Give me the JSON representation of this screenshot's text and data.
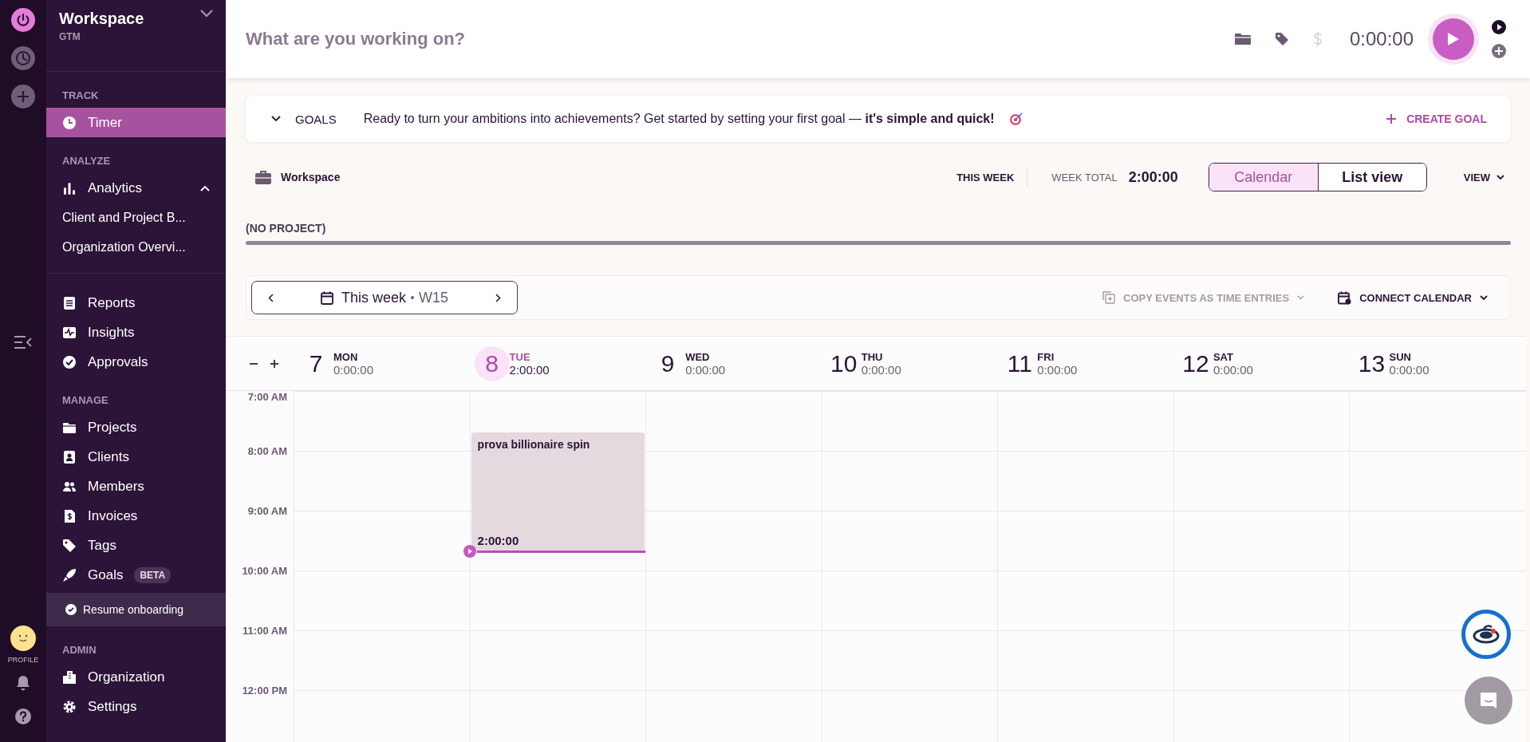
{
  "sidebar": {
    "workspace": "Workspace",
    "org": "GTM",
    "profile_label": "PROFILE",
    "sections": [
      {
        "title": "TRACK",
        "items": [
          {
            "label": "Timer",
            "selected": true
          }
        ]
      },
      {
        "title": "ANALYZE",
        "items": [
          {
            "label": "Analytics",
            "selected": false,
            "expanded": true,
            "children": [
              {
                "label": "Client and Project B...",
                "selected": false
              },
              {
                "label": "Organization Overvi...",
                "selected": false
              }
            ]
          }
        ]
      },
      {
        "items": [
          {
            "label": "Reports",
            "selected": false
          },
          {
            "label": "Insights",
            "selected": false
          },
          {
            "label": "Approvals",
            "selected": false
          }
        ]
      },
      {
        "title": "MANAGE",
        "items": [
          {
            "label": "Projects",
            "selected": false
          },
          {
            "label": "Clients",
            "selected": false
          },
          {
            "label": "Members",
            "selected": false
          },
          {
            "label": "Invoices",
            "selected": false
          },
          {
            "label": "Tags",
            "selected": false
          },
          {
            "label": "Goals",
            "badge": "BETA",
            "selected": false
          }
        ]
      },
      {
        "title": "ADMIN",
        "items": [
          {
            "label": "Organization",
            "selected": false
          },
          {
            "label": "Settings",
            "selected": false
          }
        ]
      }
    ],
    "onboarding": "Resume onboarding"
  },
  "timer": {
    "placeholder": "What are you working on?",
    "billable": false,
    "duration": "0:00:00"
  },
  "goals": {
    "label": "GOALS",
    "message": "Ready to turn your ambitions into achievements? Get started by setting your first goal — **it's simple and quick!**",
    "action": "CREATE GOAL"
  },
  "summary": {
    "workspace": "Workspace",
    "range": "THIS WEEK",
    "total_label": "WEEK TOTAL",
    "total": "2:00:00",
    "views": [
      {
        "label": "Calendar",
        "selected": true
      },
      {
        "label": "List view",
        "selected": false
      }
    ],
    "view_menu": "VIEW"
  },
  "projects": [
    {
      "name": "(NO PROJECT)",
      "level": 1
    }
  ],
  "week_nav": {
    "label": "This week",
    "week": "W15",
    "copy_action": "COPY EVENTS AS TIME ENTRIES",
    "copy_disabled": true,
    "connect_action": "CONNECT CALENDAR"
  },
  "days": [
    {
      "number": "7",
      "name": "MON",
      "total": "0:00:00",
      "selected": false
    },
    {
      "number": "8",
      "name": "TUE",
      "total": "2:00:00",
      "selected": true,
      "entries": [
        {
          "title": "prova billionaire spin",
          "duration": "2:00:00"
        }
      ]
    },
    {
      "number": "9",
      "name": "WED",
      "total": "0:00:00",
      "selected": false
    },
    {
      "number": "10",
      "name": "THU",
      "total": "0:00:00",
      "selected": false
    },
    {
      "number": "11",
      "name": "FRI",
      "total": "0:00:00",
      "selected": false
    },
    {
      "number": "12",
      "name": "SAT",
      "total": "0:00:00",
      "selected": false
    },
    {
      "number": "13",
      "name": "SUN",
      "total": "0:00:00",
      "selected": false
    }
  ],
  "hours": [
    "7:00 AM",
    "8:00 AM",
    "9:00 AM",
    "10:00 AM",
    "11:00 AM",
    "12:00 PM"
  ]
}
